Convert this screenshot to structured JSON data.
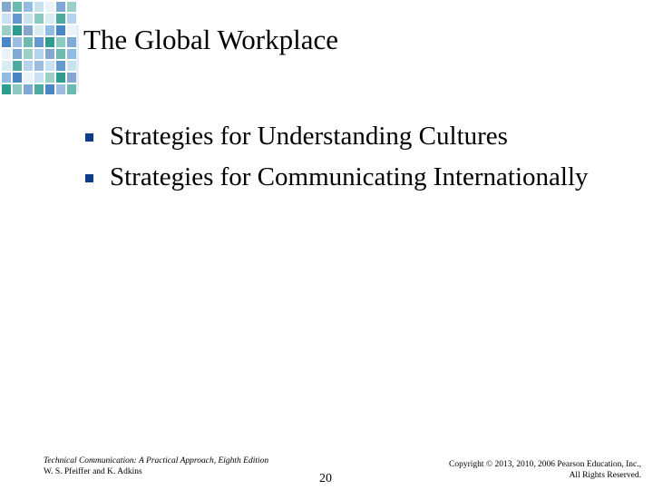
{
  "slide": {
    "title": "The Global Workplace",
    "bullets": [
      "Strategies for Understanding Cultures",
      "Strategies for Communicating Internationally"
    ],
    "footer": {
      "book": "Technical Communication: A Practical Approach, Eighth Edition",
      "authors": "W. S. Pfeiffer and K. Adkins",
      "page": "20",
      "copyright_line1": "Copyright © 2013, 2010, 2006 Pearson Education, Inc.,",
      "copyright_line2": "All Rights Reserved."
    }
  },
  "theme": {
    "bullet_color": "#0b3c8a",
    "mosaic_colors": [
      "#1f5fa8",
      "#4a86c5",
      "#7fb0de",
      "#b3d3ee",
      "#d9e8f5",
      "#2e9c8f",
      "#8cc7c0",
      "#c9e3ee"
    ]
  }
}
